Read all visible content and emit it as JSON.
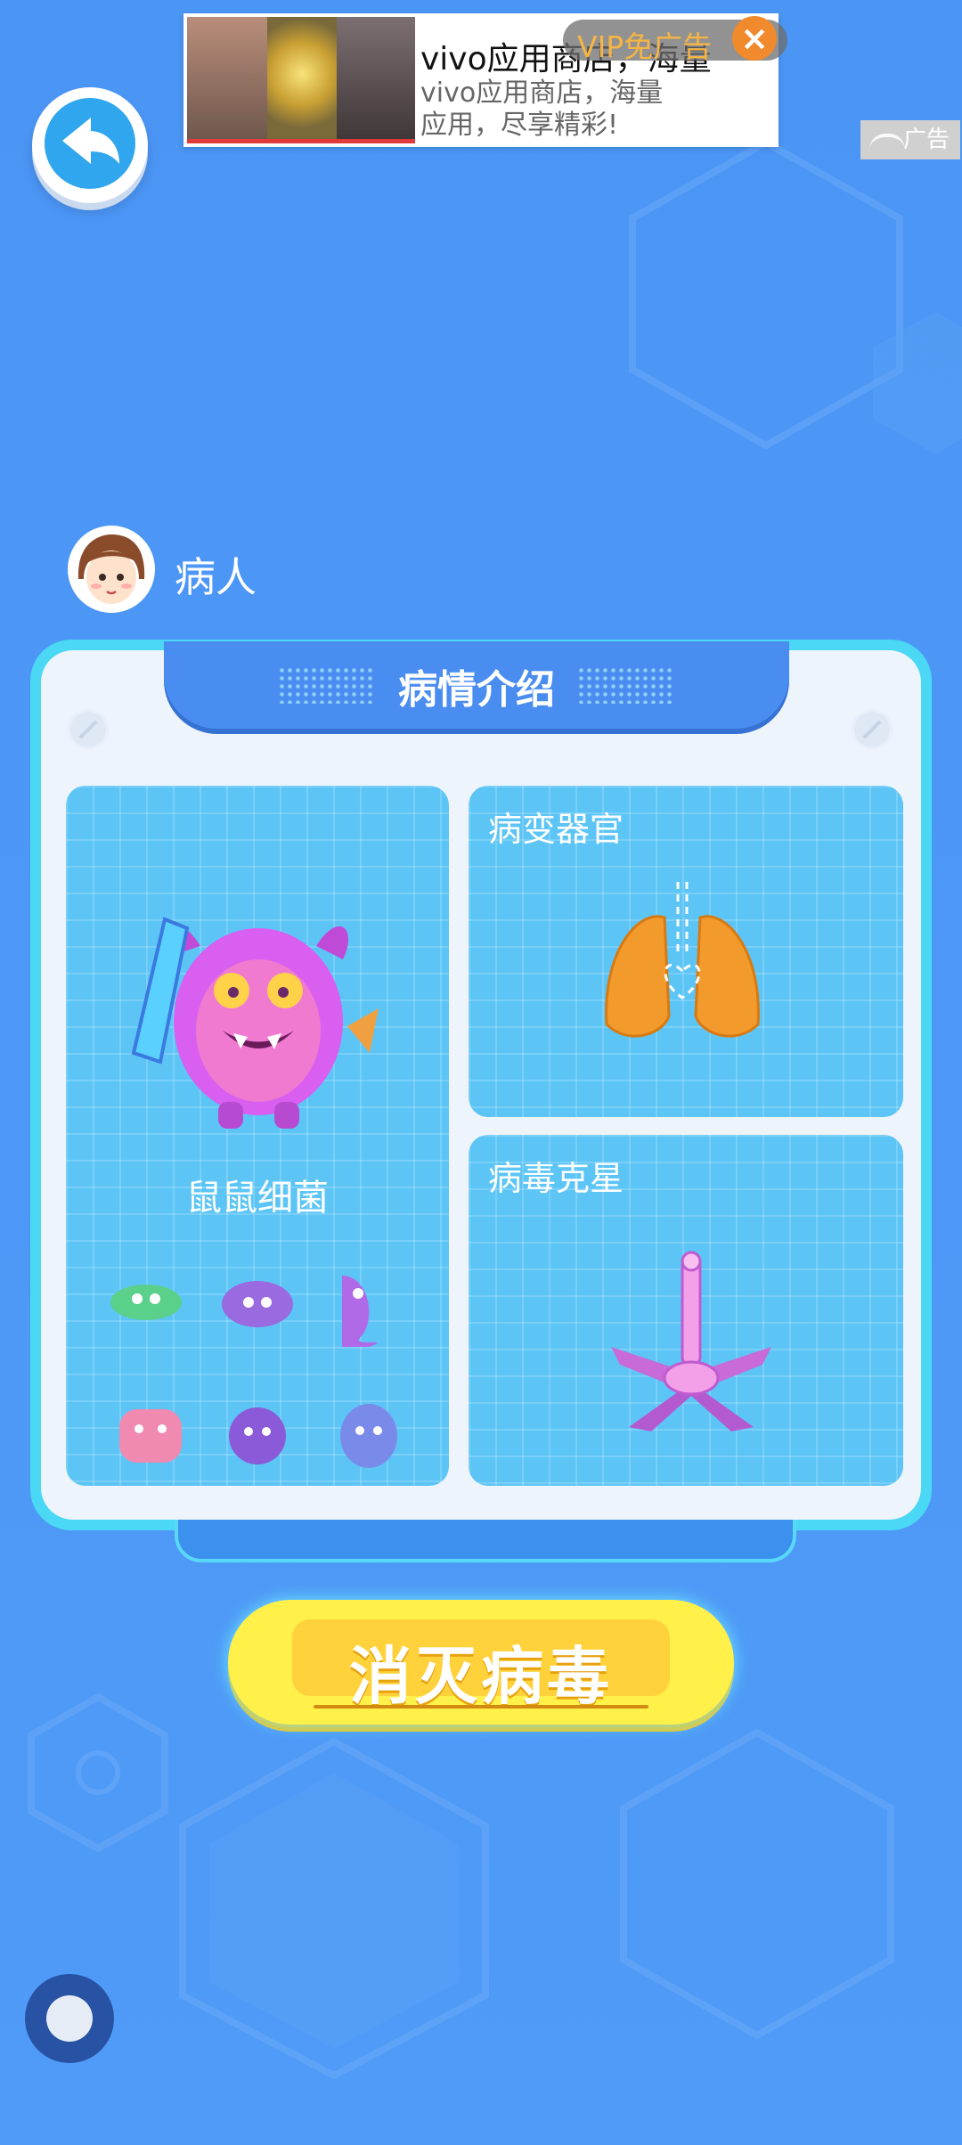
{
  "ad": {
    "title": "vivo应用商店，海量",
    "description": "vivo应用商店，海量应用，尽享精彩!",
    "vip_label": "VIP免广告",
    "close_icon": "×",
    "tag": "广告"
  },
  "back_icon": "back-arrow-icon",
  "patient": {
    "label": "病人"
  },
  "panel": {
    "title": "病情介绍",
    "bacteria_name": "鼠鼠细菌",
    "organ_label": "病变器官",
    "nemesis_label": "病毒克星"
  },
  "action": {
    "kill_label": "消灭病毒"
  },
  "colors": {
    "background": "#4e97f6",
    "panel": "#eef4fb",
    "card": "#5cc5f6",
    "button": "#fff04a"
  }
}
